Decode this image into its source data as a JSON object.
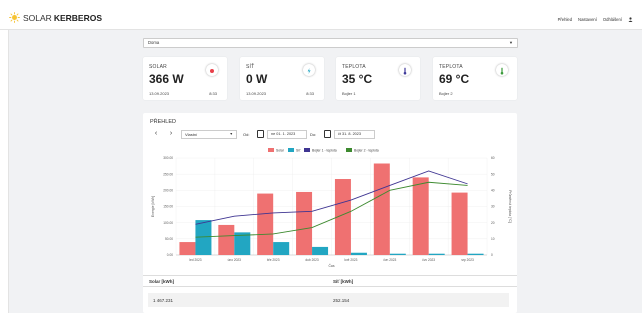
{
  "header": {
    "brand_light": "SOLAR",
    "brand_bold": "KERBEROS",
    "nav": [
      "Přehled",
      "Nastavení",
      "Odhlášení"
    ]
  },
  "location": {
    "selected": "Doma"
  },
  "cards": [
    {
      "label": "SOLAR",
      "value": "366 W",
      "sub": "13.09.2023",
      "time": "8:33",
      "icon": "sun-icon",
      "color": "#e8404a"
    },
    {
      "label": "SÍŤ",
      "value": "0 W",
      "sub": "13.09.2023",
      "time": "8:33",
      "icon": "plug-icon",
      "color": "#29a8c4"
    },
    {
      "label": "TEPLOTA",
      "value": "35 °C",
      "sub": "Bojler 1",
      "time": "",
      "icon": "thermometer-icon",
      "color": "#3f3a9a"
    },
    {
      "label": "TEPLOTA",
      "value": "69 °C",
      "sub": "Bojler 2",
      "time": "",
      "icon": "thermometer-icon",
      "color": "#3a9a3a"
    }
  ],
  "overview": {
    "title": "PŘEHLED",
    "range_select": "Vlastní",
    "from_label": "Od:",
    "from_value": "ne 01. 1. 2023",
    "to_label": "Do:",
    "to_value": "čt 31. 8. 2023"
  },
  "chart_data": {
    "type": "bar",
    "categories": [
      "led 2023",
      "úno 2023",
      "bře 2023",
      "dub 2023",
      "kvě 2023",
      "čvn 2023",
      "čvc 2023",
      "srp 2023"
    ],
    "xlabel": "Čas",
    "ylabel": "Energie [kWh]",
    "ylabel_right": "Průměrná teplota [°C]",
    "ylim": [
      0,
      300
    ],
    "yticks": [
      "0.00",
      "50.00",
      "100.00",
      "150.00",
      "200.00",
      "250.00",
      "300.00"
    ],
    "y2lim": [
      0,
      60
    ],
    "y2ticks": [
      "0",
      "10",
      "20",
      "30",
      "40",
      "50",
      "60"
    ],
    "legend_position": "top",
    "series": [
      {
        "name": "Solar",
        "kind": "bar",
        "color": "#ef7171",
        "values": [
          40,
          93,
          190,
          195,
          235,
          283,
          240,
          193
        ]
      },
      {
        "name": "Síť",
        "kind": "bar",
        "color": "#22a6c2",
        "values": [
          108,
          70,
          40,
          25,
          7,
          4,
          4,
          4
        ]
      },
      {
        "name": "Bojler 1 - teplota",
        "kind": "line",
        "color": "#3f3592",
        "values": [
          19,
          24,
          26,
          27,
          34,
          43,
          52,
          44
        ]
      },
      {
        "name": "Bojler 2 - teplota",
        "kind": "line",
        "color": "#3d8a2f",
        "values": [
          11,
          12,
          13,
          17,
          27,
          40,
          45,
          43
        ]
      }
    ]
  },
  "table": {
    "headers": [
      "Solar [kWh]",
      "Síť [kWh]"
    ],
    "row": [
      "1 467.231",
      "252.154"
    ]
  }
}
